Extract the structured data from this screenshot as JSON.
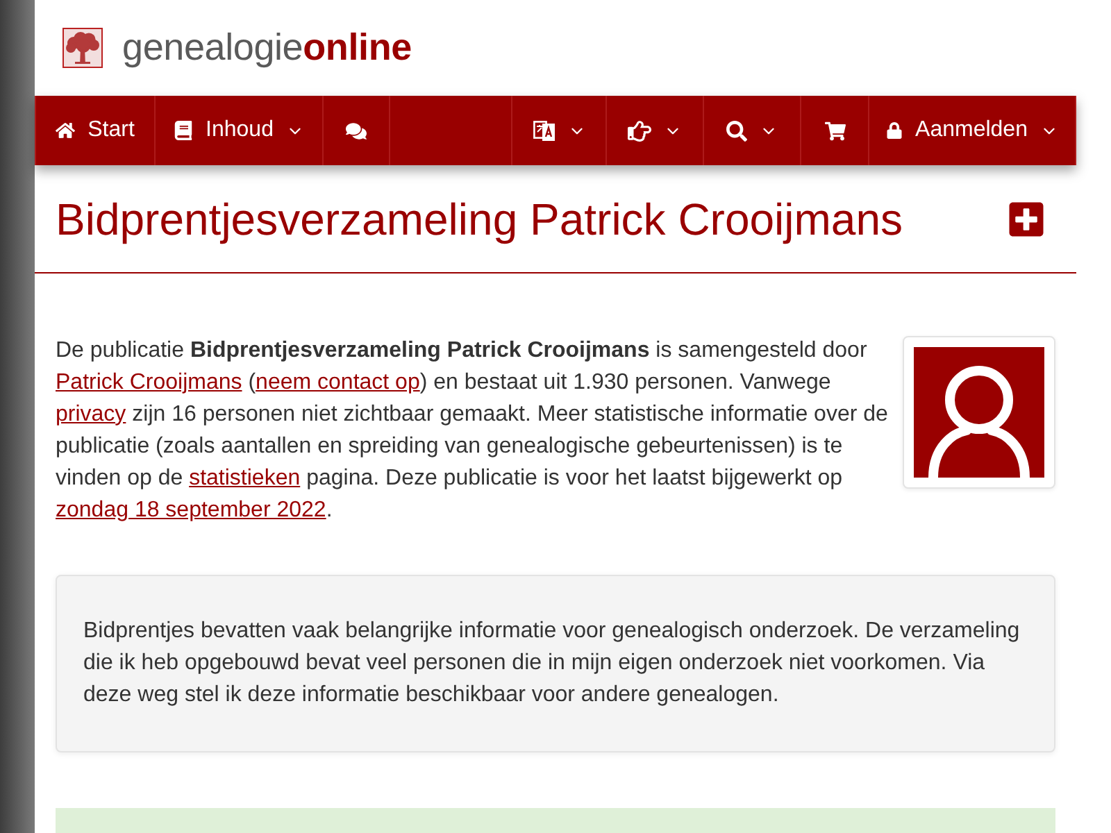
{
  "logo": {
    "text": "genealogie**online**"
  },
  "nav": {
    "left": [
      {
        "label": "Start",
        "dropdown": false
      },
      {
        "label": "Inhoud",
        "dropdown": true
      },
      {
        "dropdown": false
      }
    ],
    "right": [
      {
        "dropdown": true
      },
      {
        "dropdown": true
      },
      {
        "dropdown": true
      },
      {
        "dropdown": false
      },
      {
        "label": "Aanmelden",
        "dropdown": true
      }
    ]
  },
  "page_title": "Bidprentjesverzameling Patrick Crooijmans",
  "description": [
    {
      "kind": "text",
      "text": "De publicatie **Bidprentjesverzameling Patrick Crooijmans** is samengesteld door "
    },
    {
      "kind": "link",
      "text": "Patrick Crooijmans"
    },
    {
      "kind": "text",
      "text": " ("
    },
    {
      "kind": "link",
      "text": "neem contact op"
    },
    {
      "kind": "text",
      "text": ") en bestaat uit 1.930 personen. Vanwege "
    },
    {
      "kind": "link",
      "text": "privacy"
    },
    {
      "kind": "text",
      "text": " zijn 16 personen niet zichtbaar gemaakt. Meer statistische informatie over de publicatie (zoals aantallen en spreiding van genealogische gebeurtenissen) is te vinden op de "
    },
    {
      "kind": "link",
      "text": "statistieken"
    },
    {
      "kind": "text",
      "text": " pagina. Deze publicatie is voor het laatst bijgewerkt op "
    },
    {
      "kind": "link",
      "text": "zondag 18 september 2022"
    },
    {
      "kind": "text",
      "text": "."
    }
  ],
  "intro": "Bidprentjes bevatten vaak belangrijke informatie voor genealogisch onderzoek. De verzameling die ik heb opgebouwd bevat veel personen die in mijn eigen onderzoek niet voorkomen. Via deze weg stel ik deze informatie beschikbaar voor andere genealogen."
}
